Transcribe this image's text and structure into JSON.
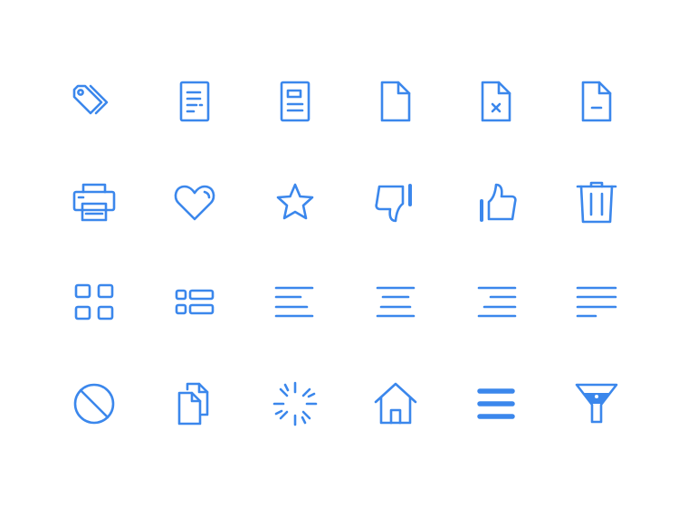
{
  "theme": {
    "icon_color": "#3b87ec",
    "background": "#ffffff"
  },
  "icons": [
    [
      "tags-icon",
      "document-text-icon",
      "document-layout-icon",
      "blank-file-icon",
      "file-remove-icon",
      "file-minus-icon"
    ],
    [
      "printer-icon",
      "heart-icon",
      "star-icon",
      "thumbs-down-icon",
      "thumbs-up-icon",
      "trash-icon"
    ],
    [
      "grid-view-icon",
      "list-view-icon",
      "align-left-icon",
      "align-center-icon",
      "align-right-icon",
      "align-justify-icon"
    ],
    [
      "ban-icon",
      "copy-files-icon",
      "loading-spinner-icon",
      "home-icon",
      "hamburger-menu-icon",
      "filter-funnel-icon"
    ]
  ]
}
